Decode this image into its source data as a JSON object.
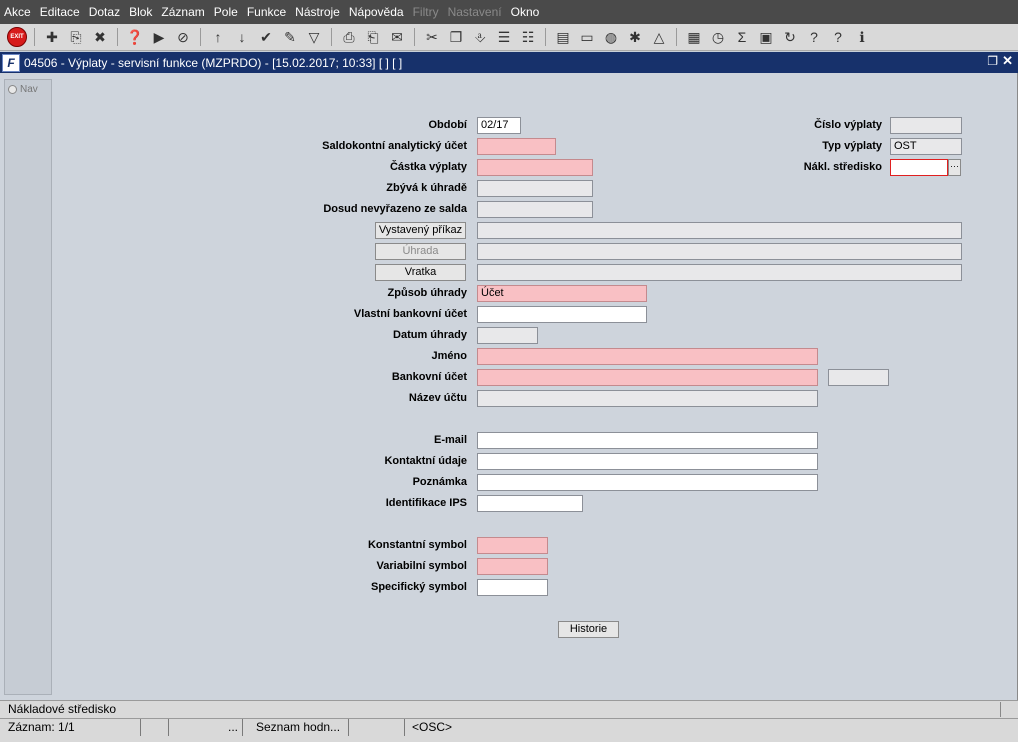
{
  "menu": [
    {
      "label": "Akce",
      "enabled": true
    },
    {
      "label": "Editace",
      "enabled": true
    },
    {
      "label": "Dotaz",
      "enabled": true
    },
    {
      "label": "Blok",
      "enabled": true
    },
    {
      "label": "Záznam",
      "enabled": true
    },
    {
      "label": "Pole",
      "enabled": true
    },
    {
      "label": "Funkce",
      "enabled": true
    },
    {
      "label": "Nástroje",
      "enabled": true
    },
    {
      "label": "Nápověda",
      "enabled": true
    },
    {
      "label": "Filtry",
      "enabled": false
    },
    {
      "label": "Nastavení",
      "enabled": false
    },
    {
      "label": "Okno",
      "enabled": true
    }
  ],
  "toolbar": {
    "exit_label": "EXIT",
    "icons": [
      "exit-icon",
      "sep",
      "add-record-icon",
      "copy-record-icon",
      "delete-record-icon",
      "sep",
      "query-icon",
      "execute-query-icon",
      "cancel-query-icon",
      "sep",
      "sort-asc-icon",
      "sort-desc-icon",
      "confirm-icon",
      "tools-icon",
      "filter-icon",
      "sep",
      "print-icon",
      "print-preview-icon",
      "mail-icon",
      "sep",
      "cut-icon",
      "copy-icon",
      "paste-icon",
      "list-icon",
      "columns-icon",
      "sep",
      "clipboard-icon",
      "document-icon",
      "globe-icon",
      "settings-wheel-icon",
      "graph-icon",
      "sep",
      "chart-icon",
      "clock-icon",
      "sum-icon",
      "excel-icon",
      "refresh-icon",
      "help-context-icon",
      "help-icon",
      "info-icon"
    ]
  },
  "window": {
    "title": "04506 - Výplaty - servisní funkce (MZPRDO) - [15.02.2017; 10:33]  [ ]  [ ]",
    "logo": "F"
  },
  "nav": {
    "label": "Nav"
  },
  "form": {
    "obdobi_label": "Období",
    "obdobi_value": "02/17",
    "saldokontni_label": "Saldokontní analytický účet",
    "castka_label": "Částka výplaty",
    "zbyva_label": "Zbývá k úhradě",
    "dosud_label": "Dosud nevyřazeno ze salda",
    "vystaveny_button": "Vystavený příkaz",
    "uhrada_button": "Úhrada",
    "vratka_button": "Vratka",
    "zpusob_label": "Způsob úhrady",
    "zpusob_value": "Účet",
    "vlastni_label": "Vlastní bankovní účet",
    "datum_label": "Datum úhrady",
    "jmeno_label": "Jméno",
    "bankovni_label": "Bankovní účet",
    "nazev_label": "Název účtu",
    "email_label": "E-mail",
    "kontaktni_label": "Kontaktní údaje",
    "poznamka_label": "Poznámka",
    "ips_label": "Identifikace IPS",
    "konstantni_label": "Konstantní symbol",
    "variabilni_label": "Variabilní symbol",
    "specificky_label": "Specifický symbol",
    "historie_button": "Historie",
    "cislo_label": "Číslo výplaty",
    "typ_label": "Typ výplaty",
    "typ_value": "OST",
    "nakl_label": "Nákl. středisko",
    "lov_button": "···"
  },
  "status": {
    "hint": "Nákladové středisko",
    "record": "Záznam: 1/1",
    "dots": "...",
    "list": "Seznam hodn...",
    "mode": "<OSC>"
  },
  "colors": {
    "required": "#f9c0c4",
    "readonly": "#e8e8ea",
    "titlebar": "#17316b",
    "menubar": "#4a4a4a"
  }
}
